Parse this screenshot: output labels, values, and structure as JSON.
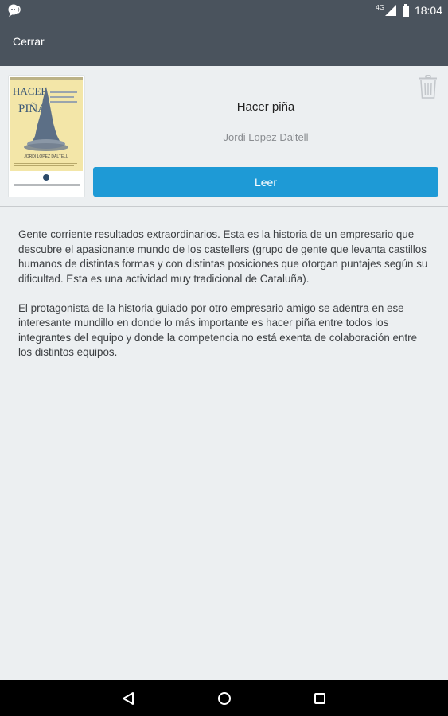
{
  "status_bar": {
    "time": "18:04",
    "network": "4G",
    "icons": [
      "talkback-icon",
      "signal-icon",
      "battery-icon"
    ]
  },
  "toolbar": {
    "close_label": "Cerrar"
  },
  "book": {
    "title": "Hacer piña",
    "author": "Jordi Lopez Daltell",
    "read_label": "Leer",
    "cover": {
      "title_line1": "HACER",
      "title_line2": "PIÑA",
      "author": "JORDI LOPEZ DALTELL"
    }
  },
  "description": {
    "paragraphs": [
      "Gente corriente resultados extraordinarios. Esta es la historia de un empresario que descubre el apasionante mundo de los castellers (grupo de gente que levanta castillos humanos de distintas formas y con distintas posiciones que otorgan puntajes según su dificultad. Esta es una actividad muy tradicional de Cataluña).",
      "El protagonista de la historia guiado por otro empresario amigo se adentra en ese interesante mundillo en donde lo más importante es hacer piña entre todos los integrantes del equipo y donde la competencia no está exenta de colaboración entre los distintos equipos."
    ]
  },
  "colors": {
    "toolbar": "#4a535d",
    "accent": "#1e9ad6",
    "background": "#eceff1"
  },
  "nav_bar": {
    "icons": [
      "back-icon",
      "home-icon",
      "recents-icon"
    ]
  }
}
